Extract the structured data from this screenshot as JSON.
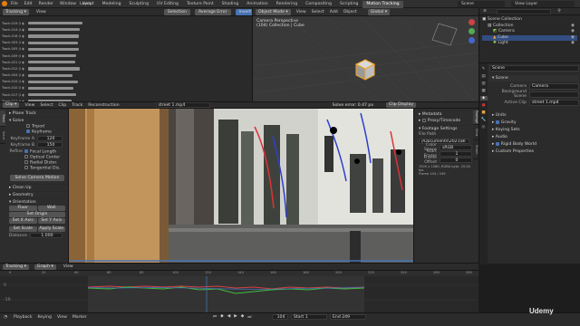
{
  "topbar": {
    "menus": [
      "File",
      "Edit",
      "Render",
      "Window",
      "Help"
    ],
    "workspaces": [
      "Layout",
      "Modeling",
      "Sculpting",
      "UV Editing",
      "Texture Paint",
      "Shading",
      "Animation",
      "Rendering",
      "Compositing",
      "Scripting",
      "Motion Tracking"
    ],
    "active_workspace": "Motion Tracking",
    "scene": "Scene",
    "view_layer": "View Layer"
  },
  "dopesheet": {
    "editor": "Tracking",
    "menus": [
      "View"
    ],
    "mode": "Selection",
    "sort": "Average Error",
    "invert": "Invert",
    "tracks": [
      {
        "name": "Track.019 (0.4459)",
        "len": 0.86
      },
      {
        "name": "Track.014 (0.4327)",
        "len": 0.82
      },
      {
        "name": "Track.016 (0.3963)",
        "len": 0.8
      },
      {
        "name": "Track.003 (0.3677)",
        "len": 0.78
      },
      {
        "name": "Track.005 (0.3500)",
        "len": 0.8
      },
      {
        "name": "Track.009 (0.3290)",
        "len": 0.76
      },
      {
        "name": "Track.021 (0.3215)",
        "len": 0.74
      },
      {
        "name": "Track.012 (0.3078)",
        "len": 0.82
      },
      {
        "name": "Track.004 (0.2997)",
        "len": 0.7
      },
      {
        "name": "Track.015 (0.2855)",
        "len": 0.78
      },
      {
        "name": "Track.010 (0.2734)",
        "len": 0.72
      },
      {
        "name": "Track.017 (0.2681)",
        "len": 0.76
      },
      {
        "name": "Track.011 (0.2576)",
        "len": 0.68
      },
      {
        "name": "Track.006 (0.2433)",
        "len": 0.74
      },
      {
        "name": "Track.008 (0.2310)",
        "len": 0.7
      },
      {
        "name": "Track.002 (0.2217)",
        "len": 0.66
      },
      {
        "name": "Track.013 (0.2109)",
        "len": 0.72
      },
      {
        "name": "Track.001 (0.1984)",
        "len": 0.64
      }
    ]
  },
  "viewport3d": {
    "menus": [
      "View",
      "Select",
      "Add",
      "Object"
    ],
    "mode": "Object Mode",
    "transform": "Global",
    "overlay_line1": "Camera Perspective",
    "overlay_line2": "(104) Collection | Cube"
  },
  "outliner": {
    "title": "Scene Collection",
    "items": [
      {
        "name": "Collection",
        "icon": "collection-icon",
        "indent": 1
      },
      {
        "name": "Camera",
        "icon": "camera-icon",
        "indent": 2
      },
      {
        "name": "Cube",
        "icon": "cube-icon",
        "indent": 2
      },
      {
        "name": "Light",
        "icon": "light-icon",
        "indent": 2
      }
    ]
  },
  "properties": {
    "header": "Scene",
    "panel_title": "Scene",
    "camera_label": "Camera",
    "camera_value": "Camera",
    "background_label": "Background Scene",
    "active_clip_label": "Active Clip",
    "active_clip_value": "street 1.mp4",
    "sections": [
      {
        "label": "Units",
        "open": false,
        "checkbox": false
      },
      {
        "label": "Gravity",
        "open": false,
        "checkbox": true
      },
      {
        "label": "Keying Sets",
        "open": false,
        "checkbox": false
      },
      {
        "label": "Audio",
        "open": false,
        "checkbox": false
      },
      {
        "label": "Rigid Body World",
        "open": false,
        "checkbox": true
      },
      {
        "label": "Custom Properties",
        "open": false,
        "checkbox": false
      }
    ]
  },
  "clip_editor": {
    "editor": "Clip",
    "menus": [
      "View",
      "Select",
      "Clip",
      "Track",
      "Reconstruction"
    ],
    "clip_name": "street 1.mp4",
    "solve_error": "Solve error: 0.47 px",
    "view_mode": "Clip Display"
  },
  "tool_panel": {
    "sections": [
      "Plane Track",
      "Solve",
      "Clean Up",
      "Geometry",
      "Orientation"
    ],
    "tripod_label": "Tripod",
    "keyframe_label": "Keyframe",
    "keyframe_a_label": "Keyframe A",
    "keyframe_a_value": "120",
    "keyframe_b_label": "Keyframe B",
    "keyframe_b_value": "150",
    "refine_label": "Refine",
    "refine_options": [
      "Focal Length",
      "Optical Center",
      "Radial Distor.",
      "Tangential Dis."
    ],
    "solve_button": "Solve Camera Motion",
    "orient_buttons": [
      "Floor",
      "Wall",
      "Set Origin",
      "Set X Axis",
      "Set Y Axis"
    ],
    "set_scale": "Set Scale",
    "apply_scale": "Apply Scale",
    "distance_label": "Distance",
    "distance_value": "1.000"
  },
  "clip_sidebar": {
    "metadata": "Metadata",
    "proxy": "Proxy/Timecode",
    "footage": "Footage Settings",
    "file_path_label": "File Path",
    "file_path": "//Documents\\2021\\Bl",
    "color_space_label": "Color Space",
    "color_space": "sRGB",
    "start_frame_label": "Start Frame",
    "start_frame": "1",
    "frame_offset_label": "Frame Offset",
    "frame_offset": "0",
    "info_line1": "1920 x 1080, RGBA byte, 25.00 fps",
    "info_line2": "Frame 104 / 249"
  },
  "graph": {
    "editor": "Tracking",
    "view_type": "Graph",
    "menus": [
      "View"
    ],
    "ruler": [
      "0",
      "20",
      "40",
      "60",
      "80",
      "100",
      "120",
      "140",
      "160",
      "180",
      "200",
      "220",
      "240",
      "260",
      "280"
    ],
    "y_ticks": [
      "0",
      "-10"
    ]
  },
  "timeline": {
    "menus": [
      "Playback",
      "Keying",
      "View",
      "Marker"
    ],
    "current_frame": "104",
    "start_label": "Start",
    "start": "1",
    "end_label": "End",
    "end": "249"
  },
  "watermark": "Udemy",
  "colors": {
    "accent": "#4772b3",
    "active_tab": "#4d4d4d",
    "panel": "#303030"
  }
}
